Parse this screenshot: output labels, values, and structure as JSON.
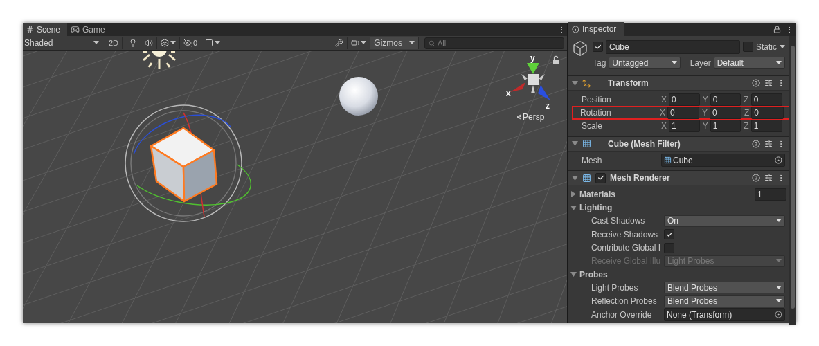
{
  "scene": {
    "tabs": [
      {
        "label": "Scene",
        "kind": "scene",
        "selected": true
      },
      {
        "label": "Game",
        "kind": "game",
        "selected": false
      }
    ],
    "toolbar": {
      "draw_mode": "Shaded",
      "view_2d": "2D",
      "hidden_count": "0",
      "gizmos": "Gizmos",
      "search_placeholder": "All"
    },
    "orientation_gizmo": {
      "y": "y",
      "x": "x",
      "z": "z",
      "projection": "Persp"
    }
  },
  "inspector": {
    "title": "Inspector",
    "object": {
      "active": true,
      "name": "Cube",
      "static_label": "Static",
      "static": false,
      "tag_label": "Tag",
      "tag": "Untagged",
      "layer_label": "Layer",
      "layer": "Default"
    },
    "components": [
      {
        "kind": "transform",
        "title": "Transform",
        "expanded": true,
        "rows": [
          {
            "label": "Position",
            "highlighted": false,
            "axes": [
              {
                "axis": "X",
                "value": "0"
              },
              {
                "axis": "Y",
                "value": "0"
              },
              {
                "axis": "Z",
                "value": "0"
              }
            ]
          },
          {
            "label": "Rotation",
            "highlighted": true,
            "axes": [
              {
                "axis": "X",
                "value": "0"
              },
              {
                "axis": "Y",
                "value": "0"
              },
              {
                "axis": "Z",
                "value": "0"
              }
            ]
          },
          {
            "label": "Scale",
            "highlighted": false,
            "axes": [
              {
                "axis": "X",
                "value": "1"
              },
              {
                "axis": "Y",
                "value": "1"
              },
              {
                "axis": "Z",
                "value": "1"
              }
            ]
          }
        ]
      },
      {
        "kind": "mesh_filter",
        "title": "Cube (Mesh Filter)",
        "expanded": true,
        "fields": [
          {
            "label": "Mesh",
            "value": "Cube",
            "asset_icon": true
          }
        ]
      },
      {
        "kind": "mesh_renderer",
        "title": "Mesh Renderer",
        "enabled": true,
        "expanded": true,
        "sections": [
          {
            "title": "Materials",
            "expanded": false,
            "count": "1"
          },
          {
            "title": "Lighting",
            "expanded": true,
            "rows": [
              {
                "kind": "dropdown",
                "label": "Cast Shadows",
                "value": "On",
                "disabled": false
              },
              {
                "kind": "checkbox",
                "label": "Receive Shadows",
                "checked": true
              },
              {
                "kind": "checkbox",
                "label": "Contribute Global I",
                "checked": false
              },
              {
                "kind": "dropdown",
                "label": "Receive Global Illu",
                "value": "Light Probes",
                "disabled": true
              }
            ]
          },
          {
            "title": "Probes",
            "expanded": true,
            "rows": [
              {
                "kind": "dropdown",
                "label": "Light Probes",
                "value": "Blend Probes",
                "disabled": false
              },
              {
                "kind": "dropdown",
                "label": "Reflection Probes",
                "value": "Blend Probes",
                "disabled": false
              },
              {
                "kind": "object",
                "label": "Anchor Override",
                "value": "None (Transform)",
                "asset_icon": false
              }
            ]
          }
        ]
      }
    ]
  }
}
